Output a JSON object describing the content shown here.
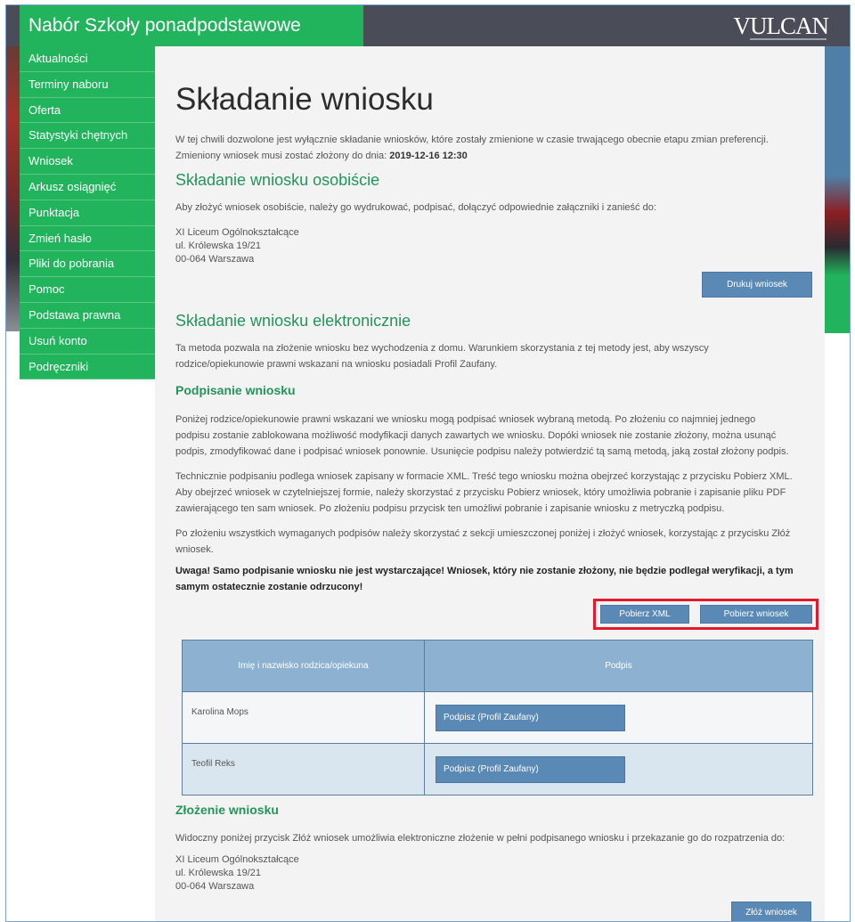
{
  "header": {
    "title": "Nabór Szkoły ponadpodstawowe",
    "logo": "VULCAN"
  },
  "sidebar": {
    "items": [
      {
        "label": "Aktualności"
      },
      {
        "label": "Terminy naboru"
      },
      {
        "label": "Oferta"
      },
      {
        "label": "Statystyki chętnych"
      },
      {
        "label": "Wniosek"
      },
      {
        "label": "Arkusz osiągnięć"
      },
      {
        "label": "Punktacja"
      },
      {
        "label": "Zmień hasło"
      },
      {
        "label": "Pliki do pobrania"
      },
      {
        "label": "Pomoc"
      },
      {
        "label": "Podstawa prawna"
      },
      {
        "label": "Usuń konto"
      },
      {
        "label": "Podręczniki"
      }
    ]
  },
  "main": {
    "title": "Składanie wniosku",
    "intro": "W tej chwili dozwolone jest wyłącznie składanie wniosków, które zostały zmienione w czasie trwającego obecnie etapu zmian preferencji.",
    "deadline_text": "Zmieniony wniosek musi zostać złożony do dnia:",
    "deadline": "2019-12-16 12:30",
    "personal": {
      "heading": "Składanie wniosku osobiście",
      "text": "Aby złożyć wniosek osobiście, należy go wydrukować, podpisać, dołączyć odpowiednie załączniki i zanieść do:",
      "address": [
        "XI Liceum Ogólnokształcące",
        "ul. Królewska 19/21",
        "00-064 Warszawa"
      ],
      "print_button": "Drukuj wniosek"
    },
    "electronic": {
      "heading": "Składanie wniosku elektronicznie",
      "text1": "Ta metoda pozwala na złożenie wniosku bez wychodzenia z domu. Warunkiem skorzystania z tej metody jest, aby wszyscy",
      "text2": "rodzice/opiekunowie prawni wskazani na wniosku posiadali Profil Zaufany.",
      "signing_heading": "Podpisanie wniosku",
      "sign_p1": [
        "Poniżej rodzice/opiekunowie prawni wskazani we wniosku mogą podpisać wniosek wybraną metodą. Po złożeniu co najmniej jednego",
        "podpisu zostanie zablokowana możliwość modyfikacji danych zawartych we wniosku. Dopóki wniosek nie zostanie złożony, można usunąć",
        "podpis, zmodyfikować dane i podpisać wniosek ponownie. Usunięcie podpisu należy potwierdzić tą samą metodą, jaką został złożony podpis."
      ],
      "sign_p2": [
        "Technicznie podpisaniu podlega wniosek zapisany w formacie XML. Treść tego wniosku można obejrzeć korzystając z przycisku Pobierz XML.",
        "Aby obejrzeć wniosek w czytelniejszej formie, należy skorzystać z przycisku Pobierz wniosek, który umożliwia pobranie i zapisanie pliku PDF",
        "zawierającego ten sam wniosek. Po złożeniu podpisu przycisk ten umożliwi pobranie i zapisanie wniosku z metryczką podpisu."
      ],
      "sign_p3": [
        "Po złożeniu wszystkich wymaganych podpisów należy skorzystać z sekcji umieszczonej poniżej i złożyć wniosek, korzystając z przycisku Złóż",
        "wniosek."
      ],
      "warning": [
        "Uwaga! Samo podpisanie wniosku nie jest wystarczające! Wniosek, który nie zostanie złożony, nie będzie podlegał weryfikacji, a tym",
        "samym ostatecznie zostanie odrzucony!"
      ],
      "btn_xml": "Pobierz XML",
      "btn_pdf": "Pobierz wniosek",
      "table": {
        "col1": "Imię i nazwisko rodzica/opiekuna",
        "col2": "Podpis",
        "rows": [
          {
            "name": "Karolina Mops",
            "action": "Podpisz (Profil Zaufany)"
          },
          {
            "name": "Teofil Reks",
            "action": "Podpisz (Profil Zaufany)"
          }
        ]
      }
    },
    "submit": {
      "heading": "Złożenie wniosku",
      "text": "Widoczny poniżej przycisk Złóż wniosek umożliwia elektroniczne złożenie w pełni podpisanego wniosku i przekazanie go do rozpatrzenia do:",
      "address": [
        "XI Liceum Ogólnokształcące",
        "ul. Królewska 19/21",
        "00-064 Warszawa"
      ],
      "button": "Złóż wniosek"
    }
  },
  "colors": {
    "green": "#22b45c",
    "header_dark": "#4a4d57",
    "button_blue": "#5b89b5",
    "highlight_red": "#e21a2c"
  }
}
